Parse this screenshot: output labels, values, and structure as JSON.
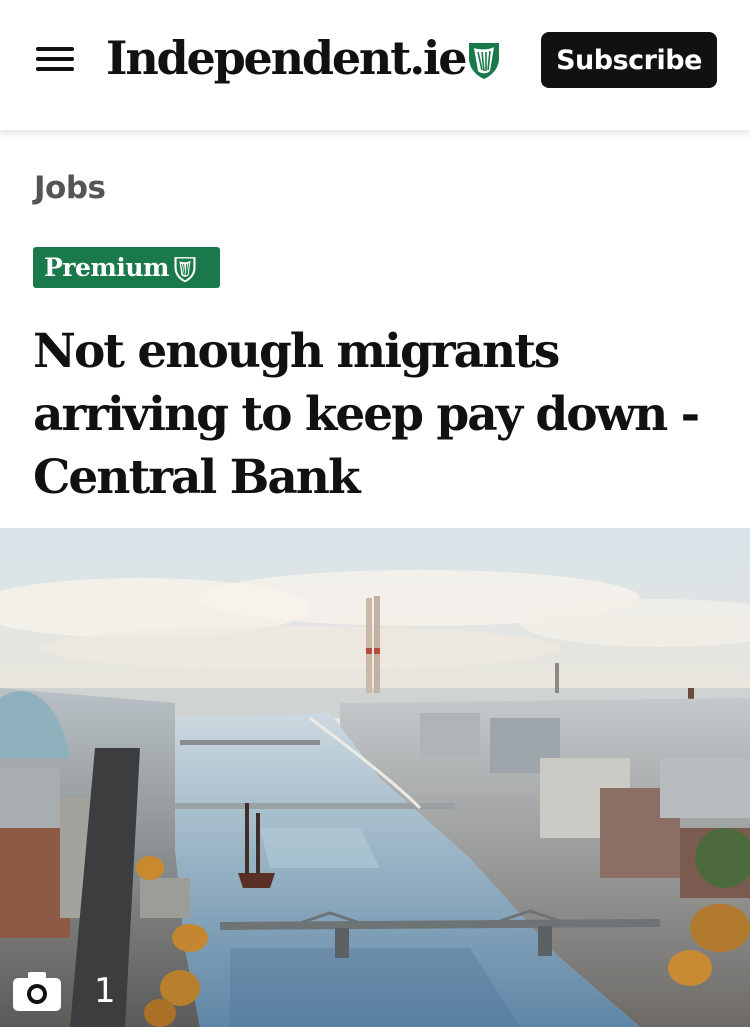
{
  "header": {
    "logo_text": "Independent.ie",
    "subscribe_label": "Subscribe",
    "icons": {
      "menu": "hamburger-menu-icon",
      "brand": "harp-shield-icon"
    }
  },
  "article": {
    "section": "Jobs",
    "badge": "Premium",
    "headline": "Not enough migrants arriving to keep pay down - Central Bank"
  },
  "media": {
    "image_count": "1",
    "icon": "camera-icon"
  },
  "colors": {
    "premium_green": "#19794a",
    "subscribe_bg": "#111111",
    "section_gray": "#555555"
  }
}
